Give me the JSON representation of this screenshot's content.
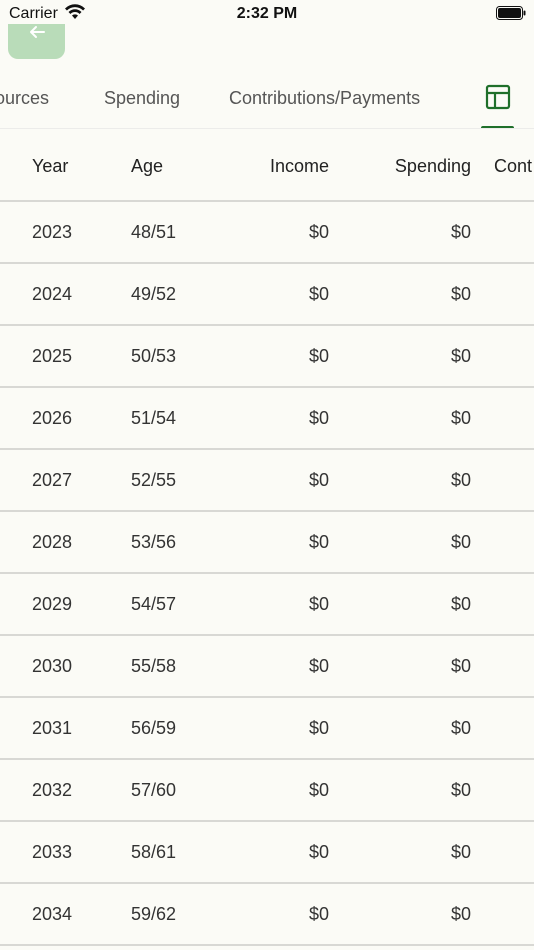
{
  "status_bar": {
    "carrier": "Carrier",
    "time": "2:32 PM"
  },
  "colors": {
    "accent": "#1f6f2a",
    "back_button_bg": "#b9dcb9",
    "background": "#fbfbf6",
    "divider": "#d8d8d4"
  },
  "nav": {
    "back_icon": "arrow-left-icon"
  },
  "tabs": {
    "sources_label": "ources",
    "spending_label": "Spending",
    "contributions_label": "Contributions/Payments",
    "table_icon": "table-icon",
    "selected": "table"
  },
  "table": {
    "headers": {
      "year": "Year",
      "age": "Age",
      "income": "Income",
      "spending": "Spending",
      "contrib": "Cont"
    },
    "rows": [
      {
        "year": "2023",
        "age": "48/51",
        "income": "$0",
        "spending": "$0"
      },
      {
        "year": "2024",
        "age": "49/52",
        "income": "$0",
        "spending": "$0"
      },
      {
        "year": "2025",
        "age": "50/53",
        "income": "$0",
        "spending": "$0"
      },
      {
        "year": "2026",
        "age": "51/54",
        "income": "$0",
        "spending": "$0"
      },
      {
        "year": "2027",
        "age": "52/55",
        "income": "$0",
        "spending": "$0"
      },
      {
        "year": "2028",
        "age": "53/56",
        "income": "$0",
        "spending": "$0"
      },
      {
        "year": "2029",
        "age": "54/57",
        "income": "$0",
        "spending": "$0"
      },
      {
        "year": "2030",
        "age": "55/58",
        "income": "$0",
        "spending": "$0"
      },
      {
        "year": "2031",
        "age": "56/59",
        "income": "$0",
        "spending": "$0"
      },
      {
        "year": "2032",
        "age": "57/60",
        "income": "$0",
        "spending": "$0"
      },
      {
        "year": "2033",
        "age": "58/61",
        "income": "$0",
        "spending": "$0"
      },
      {
        "year": "2034",
        "age": "59/62",
        "income": "$0",
        "spending": "$0"
      }
    ]
  }
}
